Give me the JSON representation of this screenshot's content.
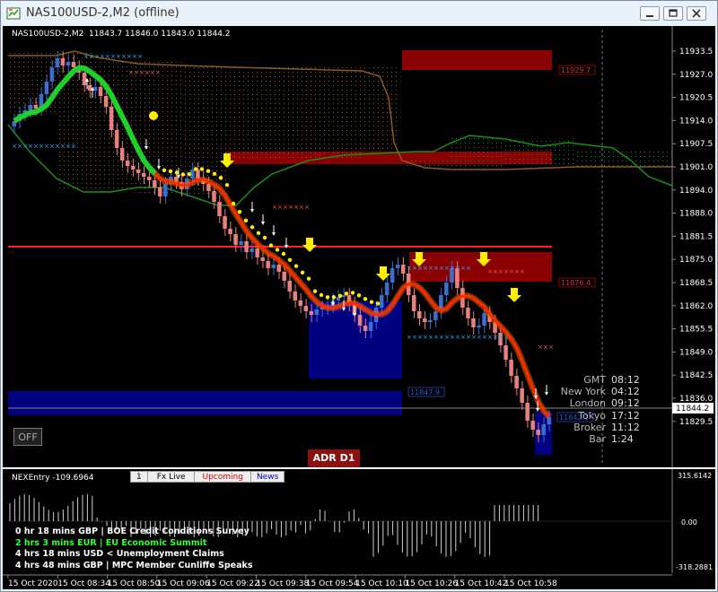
{
  "window": {
    "title": "NAS100USD-2,M2 (offline)",
    "buttons": [
      "minimize-button",
      "restore-button",
      "close-button"
    ]
  },
  "header": {
    "symbol_line": "NAS100USD-2,M2  11843.7 11846.0 11843.0 11844.2"
  },
  "price_axis": {
    "ticks": [
      "11933.5",
      "11927.0",
      "11920.5",
      "11914.0",
      "11907.5",
      "11901.0",
      "11894.0",
      "11888.0",
      "11881.5",
      "11875.0",
      "11868.5",
      "11862.0",
      "11855.5",
      "11849.0",
      "11842.5",
      "11836.0",
      "11829.5"
    ],
    "current_price": "11844.2"
  },
  "level_labels": [
    "11929.7",
    "11876.4",
    "11847.9",
    "11842.1"
  ],
  "time_axis": [
    "15 Oct 2020",
    "15 Oct 08:34",
    "15 Oct 08:50",
    "15 Oct 09:06",
    "15 Oct 09:22",
    "15 Oct 09:38",
    "15 Oct 09:54",
    "15 Oct 10:10",
    "15 Oct 10:26",
    "15 Oct 10:42",
    "15 Oct 10:58"
  ],
  "off_button": "OFF",
  "adr_badge": "ADR D1",
  "sessions": [
    {
      "name": "GMT",
      "time": "08:12"
    },
    {
      "name": "New York",
      "time": "04:12"
    },
    {
      "name": "London",
      "time": "09:12"
    },
    {
      "name": "Tokyo",
      "time": "17:12"
    },
    {
      "name": "Broker",
      "time": "11:12"
    },
    {
      "name": "Bar",
      "time": "1:24"
    }
  ],
  "indicator": {
    "label": "NEXEntry -109.6964",
    "axis": [
      "315.6142",
      "0.00",
      "-318.2881"
    ]
  },
  "tabs": {
    "num": "1",
    "fxlive": "Fx Live",
    "upcoming": "Upcoming",
    "news": "News"
  },
  "news_items": [
    {
      "text": "0 hr 18 mins  GBP  |  BOE Credit Conditions Survey",
      "color": "#ffffff"
    },
    {
      "text": "2 hrs 3 mins  EUR  |  EU Economic Summit",
      "color": "#33ff33"
    },
    {
      "text": "4 hrs 18 mins  USD  <  Unemployment Claims",
      "color": "#ffffff"
    },
    {
      "text": "4 hrs 48 mins  GBP  |  MPC Member Cunliffe Speaks",
      "color": "#ffffff"
    }
  ],
  "colors": {
    "bull_candle": "#3a6fd0",
    "bear_candle": "#e88080",
    "supply_zone": "#8b0000",
    "demand_zone": "#000080",
    "cloud_line": "#8b5a2b",
    "kijun_line": "#1a8f1a",
    "ma_line": "#ff2a00",
    "resistance_line": "#ff2222"
  }
}
